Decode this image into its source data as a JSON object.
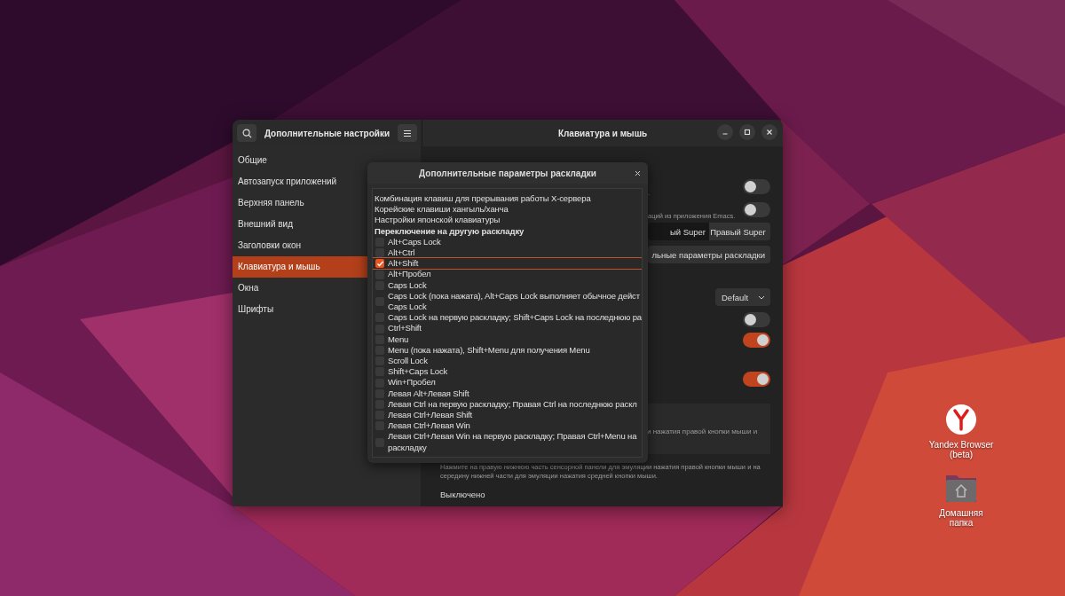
{
  "desktop_icons": [
    {
      "kind": "browser",
      "label": "Yandex Browser (beta)"
    },
    {
      "kind": "folder",
      "label": "Домашняя папка"
    }
  ],
  "window": {
    "sidebar_title": "Дополнительные настройки",
    "title": "Клавиатура и мышь",
    "sidebar": {
      "items": [
        {
          "label": "Общие",
          "selected": false
        },
        {
          "label": "Автозапуск приложений",
          "selected": false
        },
        {
          "label": "Верхняя панель",
          "selected": false
        },
        {
          "label": "Внешний вид",
          "selected": false
        },
        {
          "label": "Заголовки окон",
          "selected": false
        },
        {
          "label": "Клавиатура и мышь",
          "selected": true
        },
        {
          "label": "Окна",
          "selected": false
        },
        {
          "label": "Шрифты",
          "selected": false
        }
      ]
    },
    "rows": [
      {
        "kind": "toggle",
        "text": ".",
        "on": false
      },
      {
        "kind": "toggle",
        "text": "аций из приложения Emacs.",
        "on": false
      },
      {
        "kind": "segmented",
        "options": [
          {
            "label": "ый Super",
            "selected": true
          },
          {
            "label": "Правый Super",
            "selected": false
          }
        ]
      },
      {
        "kind": "button",
        "label": "льные параметры раскладки"
      },
      {
        "kind": "dropdown",
        "value": "Default"
      },
      {
        "kind": "toggle",
        "on": false
      },
      {
        "kind": "toggle",
        "on": true
      },
      {
        "kind": "toggle",
        "on": true
      }
    ],
    "card_text": "и нажатия правой кнопки мыши и",
    "description": "Нажмите на правую нижнюю часть сенсорной панели для эмуляции нажатия правой кнопки мыши и на середину нижней части для эмуляции нажатия средней кнопки мыши.",
    "option": "Выключено"
  },
  "dialog": {
    "title": "Дополнительные параметры раскладки",
    "items": [
      {
        "kind": "option",
        "label": "Комбинация клавиш для прерывания работы X-сервера"
      },
      {
        "kind": "option",
        "label": "Корейские клавиши хангыль/ханча"
      },
      {
        "kind": "option",
        "label": "Настройки японской клавиатуры"
      },
      {
        "kind": "group",
        "label": "Переключение на другую раскладку"
      },
      {
        "kind": "check",
        "label": "Alt+Caps Lock",
        "checked": false,
        "selected": false
      },
      {
        "kind": "check",
        "label": "Alt+Ctrl",
        "checked": false,
        "selected": false
      },
      {
        "kind": "check",
        "label": "Alt+Shift",
        "checked": true,
        "selected": true
      },
      {
        "kind": "check",
        "label": "Alt+Пробел",
        "checked": false,
        "selected": false
      },
      {
        "kind": "check",
        "label": "Caps Lock",
        "checked": false,
        "selected": false
      },
      {
        "kind": "check",
        "label": "Caps Lock (пока нажата), Alt+Caps Lock выполняет обычное дейст",
        "continuation": "Caps Lock",
        "checked": false,
        "selected": false
      },
      {
        "kind": "check",
        "label": "Caps Lock на первую раскладку; Shift+Caps Lock на последнюю ра",
        "checked": false,
        "selected": false
      },
      {
        "kind": "check",
        "label": "Ctrl+Shift",
        "checked": false,
        "selected": false
      },
      {
        "kind": "check",
        "label": "Menu",
        "checked": false,
        "selected": false
      },
      {
        "kind": "check",
        "label": "Menu (пока нажата), Shift+Menu для получения Menu",
        "checked": false,
        "selected": false
      },
      {
        "kind": "check",
        "label": "Scroll Lock",
        "checked": false,
        "selected": false
      },
      {
        "kind": "check",
        "label": "Shift+Caps Lock",
        "checked": false,
        "selected": false
      },
      {
        "kind": "check",
        "label": "Win+Пробел",
        "checked": false,
        "selected": false
      },
      {
        "kind": "check",
        "label": "Левая Alt+Левая Shift",
        "checked": false,
        "selected": false
      },
      {
        "kind": "check",
        "label": "Левая Ctrl на первую раскладку; Правая Ctrl на последнюю раскл",
        "checked": false,
        "selected": false
      },
      {
        "kind": "check",
        "label": "Левая Ctrl+Левая Shift",
        "checked": false,
        "selected": false
      },
      {
        "kind": "check",
        "label": "Левая Ctrl+Левая Win",
        "checked": false,
        "selected": false
      },
      {
        "kind": "check",
        "label": "Левая Ctrl+Левая Win на первую раскладку; Правая Ctrl+Menu на",
        "continuation": "раскладку",
        "checked": false,
        "selected": false
      }
    ]
  }
}
